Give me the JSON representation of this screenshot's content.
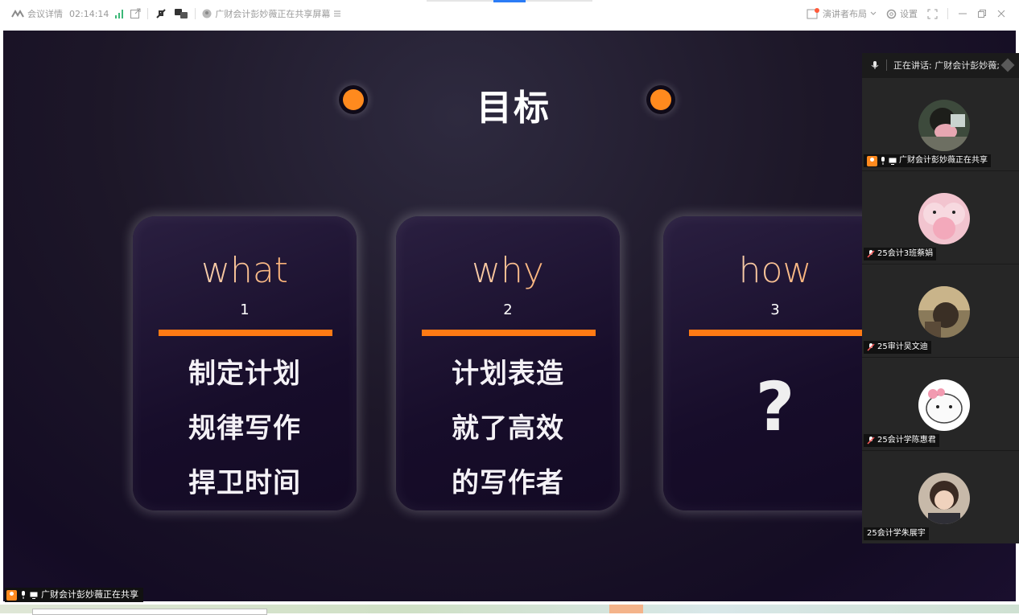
{
  "topbar": {
    "meeting_details": "会议详情",
    "timer": "02:14:14",
    "sharing_title": "广财会计彭妙薇正在共享屏幕",
    "layout_label": "演讲者布局",
    "settings_label": "设置"
  },
  "slide": {
    "title": "目标",
    "cards": [
      {
        "word": "what",
        "number": "1",
        "lines": [
          "制定计划",
          "规律写作",
          "捍卫时间"
        ]
      },
      {
        "word": "why",
        "number": "2",
        "lines": [
          "计划表造",
          "就了高效",
          "的写作者"
        ]
      },
      {
        "word": "how",
        "number": "3",
        "mark": "?"
      }
    ],
    "colors": {
      "accent": "#ff7a14",
      "background": "#1a1128"
    }
  },
  "panel": {
    "speaking_label": "正在讲话: 广财会计彭妙薇;",
    "participants": [
      {
        "name": "广财会计彭妙薇正在共享",
        "host": true
      },
      {
        "name": "25会计3班蔡娟"
      },
      {
        "name": "25审计吴文迪"
      },
      {
        "name": "25会计学陈惠君"
      },
      {
        "name": "25会计学朱展宇"
      }
    ]
  },
  "share_tag": {
    "label": "广财会计彭妙薇正在共享"
  }
}
